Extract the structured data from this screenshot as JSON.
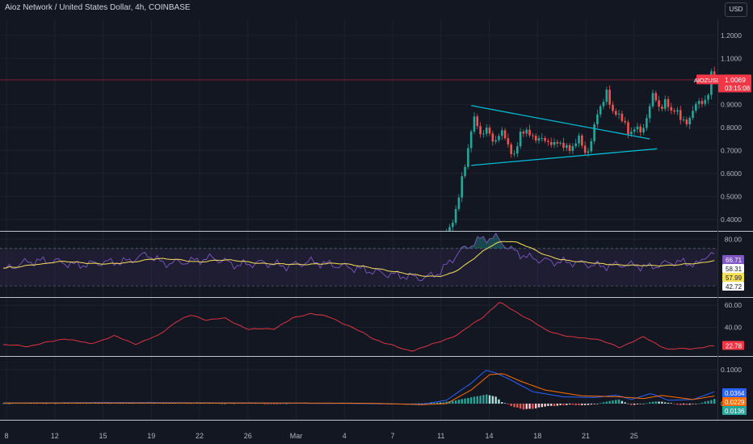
{
  "header": {
    "title": "Aioz Network / United States Dollar, 4h, COINBASE",
    "currency": "USD"
  },
  "colors": {
    "up": "#26a69a",
    "down": "#ef5350",
    "accent": "#f23645",
    "rsi": "#7e57c2",
    "rsi_ma": "#f7e05a",
    "adx": "#f23645",
    "macd": "#2962ff",
    "signal": "#ff6d00",
    "trendline": "#00bcd4"
  },
  "chart_data": [
    {
      "type": "candlestick",
      "title": "",
      "ticker": "AIOZUSD",
      "last_price": "1.0069",
      "countdown": "03:15:08",
      "y_ticks": [
        "1.2000",
        "1.1000",
        "0.9000",
        "0.8000",
        "0.7000",
        "0.6000",
        "0.5000",
        "0.4000"
      ],
      "ylim": [
        0.35,
        1.27
      ],
      "x_ticks": [
        "8",
        "12",
        "15",
        "19",
        "22",
        "26",
        "Mar",
        "4",
        "7",
        "11",
        "14",
        "18",
        "21",
        "25"
      ],
      "price_line": 1.0069,
      "anchors": [
        [
          36.0,
          0.33
        ],
        [
          36.3,
          0.36
        ],
        [
          36.6,
          0.42
        ],
        [
          37.0,
          0.5
        ],
        [
          37.3,
          0.58
        ],
        [
          37.6,
          0.66
        ],
        [
          38.0,
          0.8
        ],
        [
          38.3,
          0.84
        ],
        [
          38.7,
          0.76
        ],
        [
          39.2,
          0.81
        ],
        [
          39.8,
          0.72
        ],
        [
          40.4,
          0.8
        ],
        [
          41.0,
          0.71
        ],
        [
          41.5,
          0.69
        ],
        [
          42.0,
          0.76
        ],
        [
          42.6,
          0.8
        ],
        [
          43.2,
          0.73
        ],
        [
          43.8,
          0.77
        ],
        [
          44.4,
          0.71
        ],
        [
          45.0,
          0.75
        ],
        [
          45.6,
          0.7
        ],
        [
          46.2,
          0.72
        ],
        [
          46.7,
          0.75
        ],
        [
          47.3,
          0.69
        ],
        [
          47.8,
          0.74
        ],
        [
          48.1,
          0.83
        ],
        [
          48.5,
          0.9
        ],
        [
          49.0,
          0.95
        ],
        [
          49.4,
          0.86
        ],
        [
          49.8,
          0.88
        ],
        [
          50.3,
          0.82
        ],
        [
          50.8,
          0.78
        ],
        [
          51.3,
          0.8
        ],
        [
          51.8,
          0.77
        ],
        [
          52.3,
          0.86
        ],
        [
          52.8,
          0.94
        ],
        [
          53.3,
          0.89
        ],
        [
          53.8,
          0.91
        ],
        [
          54.2,
          0.86
        ],
        [
          54.6,
          0.9
        ],
        [
          55.0,
          0.83
        ],
        [
          55.4,
          0.81
        ],
        [
          55.9,
          0.87
        ],
        [
          56.4,
          0.9
        ],
        [
          56.9,
          0.92
        ],
        [
          57.3,
          0.95
        ],
        [
          57.6,
          1.06
        ],
        [
          57.85,
          1.01
        ]
      ],
      "annotations": [
        {
          "type": "trendline",
          "from": [
            38.0,
            0.895
          ],
          "to": [
            52.5,
            0.75
          ]
        },
        {
          "type": "trendline",
          "from": [
            38.0,
            0.635
          ],
          "to": [
            53.1,
            0.707
          ]
        }
      ]
    },
    {
      "type": "line",
      "title": "",
      "y_ticks": [
        "80.00"
      ],
      "ylim": [
        18,
        88
      ],
      "band": [
        70,
        30
      ],
      "values_shown": [
        "66.71",
        "58.31",
        "57.99",
        "42.72"
      ],
      "anchors": [
        [
          0,
          47
        ],
        [
          2,
          56
        ],
        [
          4,
          57
        ],
        [
          6,
          52
        ],
        [
          8,
          55
        ],
        [
          10,
          56
        ],
        [
          11.7,
          64
        ],
        [
          13,
          54
        ],
        [
          15,
          56
        ],
        [
          17,
          60
        ],
        [
          19,
          52
        ],
        [
          21,
          55
        ],
        [
          23,
          51
        ],
        [
          25,
          56
        ],
        [
          27,
          52
        ],
        [
          29,
          48
        ],
        [
          31,
          43
        ],
        [
          33,
          40
        ],
        [
          34.2,
          38
        ],
        [
          35.5,
          45
        ],
        [
          37,
          66
        ],
        [
          38.7,
          80
        ],
        [
          40,
          82
        ],
        [
          41.2,
          69
        ],
        [
          42.7,
          60
        ],
        [
          44.5,
          56
        ],
        [
          46.5,
          55
        ],
        [
          48.5,
          51
        ],
        [
          50.5,
          53
        ],
        [
          52.5,
          50
        ],
        [
          54.5,
          56
        ],
        [
          56.5,
          53
        ],
        [
          57.3,
          66
        ],
        [
          57.85,
          62
        ]
      ]
    },
    {
      "type": "line",
      "title": "",
      "y_ticks": [
        "60.00",
        "40.00"
      ],
      "ylim": [
        14,
        66
      ],
      "values_shown": [
        "22.78"
      ],
      "anchors": [
        [
          0,
          24
        ],
        [
          2,
          23
        ],
        [
          3.5,
          26
        ],
        [
          5,
          30
        ],
        [
          7,
          25
        ],
        [
          9,
          32
        ],
        [
          10.8,
          25
        ],
        [
          12.5,
          32
        ],
        [
          14,
          45
        ],
        [
          15.3,
          51
        ],
        [
          16.5,
          47
        ],
        [
          18,
          48
        ],
        [
          20,
          38
        ],
        [
          22,
          39
        ],
        [
          23.5,
          48
        ],
        [
          25,
          53
        ],
        [
          26.5,
          49
        ],
        [
          28,
          42
        ],
        [
          30,
          30
        ],
        [
          32.5,
          20
        ],
        [
          33.2,
          19
        ],
        [
          35,
          25
        ],
        [
          37,
          34
        ],
        [
          39,
          50
        ],
        [
          40.3,
          62.5
        ],
        [
          42,
          52
        ],
        [
          44,
          38
        ],
        [
          46,
          31
        ],
        [
          48,
          30
        ],
        [
          50,
          22
        ],
        [
          52,
          31
        ],
        [
          54,
          20
        ],
        [
          56,
          21
        ],
        [
          57.85,
          23
        ]
      ]
    },
    {
      "type": "bar",
      "title": "",
      "y_ticks": [
        "0.1000",
        "0.0000"
      ],
      "ylim": [
        -0.045,
        0.135
      ],
      "values_shown": [
        "0.0364",
        "0.0229",
        "0.0136"
      ],
      "series": [
        {
          "name": "",
          "anchors": [
            [
              0,
              0.002
            ],
            [
              10,
              0.003
            ],
            [
              20,
              0.002
            ],
            [
              30,
              0.0
            ],
            [
              34,
              -0.002
            ],
            [
              36,
              0.01
            ],
            [
              38,
              0.06
            ],
            [
              39.2,
              0.098
            ],
            [
              40,
              0.09
            ],
            [
              41.2,
              0.07
            ],
            [
              43,
              0.035
            ],
            [
              45.5,
              0.02
            ],
            [
              48,
              0.018
            ],
            [
              49.8,
              0.025
            ],
            [
              51,
              0.012
            ],
            [
              52.6,
              0.03
            ],
            [
              54,
              0.01
            ],
            [
              56,
              0.012
            ],
            [
              57.85,
              0.036
            ]
          ]
        },
        {
          "name": "",
          "anchors": [
            [
              0,
              0.002
            ],
            [
              10,
              0.002
            ],
            [
              20,
              0.002
            ],
            [
              30,
              0.001
            ],
            [
              34,
              -0.003
            ],
            [
              36,
              0.0
            ],
            [
              38,
              0.04
            ],
            [
              39.5,
              0.085
            ],
            [
              40.6,
              0.088
            ],
            [
              42,
              0.066
            ],
            [
              44,
              0.04
            ],
            [
              47,
              0.023
            ],
            [
              50,
              0.02
            ],
            [
              52,
              0.015
            ],
            [
              53.5,
              0.024
            ],
            [
              56,
              0.012
            ],
            [
              57.85,
              0.023
            ]
          ]
        }
      ],
      "histogram_anchors": [
        [
          0,
          0.0
        ],
        [
          2,
          0.003
        ],
        [
          4,
          0.001
        ],
        [
          6,
          0.003
        ],
        [
          8,
          0.004
        ],
        [
          10,
          0.002
        ],
        [
          12,
          0.004
        ],
        [
          14,
          0.002
        ],
        [
          16,
          0.004
        ],
        [
          18,
          0.001
        ],
        [
          20,
          0.003
        ],
        [
          22,
          -0.001
        ],
        [
          24,
          0.003
        ],
        [
          26,
          0.002
        ],
        [
          28,
          0.003
        ],
        [
          30,
          -0.001
        ],
        [
          32,
          -0.002
        ],
        [
          34,
          0.001
        ],
        [
          35.5,
          0.003
        ],
        [
          36.5,
          0.008
        ],
        [
          37.5,
          0.015
        ],
        [
          38.5,
          0.022
        ],
        [
          39.3,
          0.027
        ],
        [
          40,
          0.02
        ],
        [
          40.5,
          0.005
        ],
        [
          41.5,
          -0.01
        ],
        [
          42.3,
          -0.017
        ],
        [
          43.2,
          -0.014
        ],
        [
          44,
          -0.008
        ],
        [
          45,
          -0.006
        ],
        [
          46,
          -0.003
        ],
        [
          47,
          -0.005
        ],
        [
          48,
          -0.002
        ],
        [
          49.4,
          0.009
        ],
        [
          50,
          0.012
        ],
        [
          50.5,
          0.004
        ],
        [
          51,
          -0.004
        ],
        [
          52,
          0.0
        ],
        [
          53,
          0.007
        ],
        [
          54,
          0.003
        ],
        [
          55,
          -0.004
        ],
        [
          56,
          -0.002
        ],
        [
          56.8,
          0.003
        ],
        [
          57.4,
          0.01
        ],
        [
          57.85,
          0.014
        ]
      ]
    }
  ]
}
